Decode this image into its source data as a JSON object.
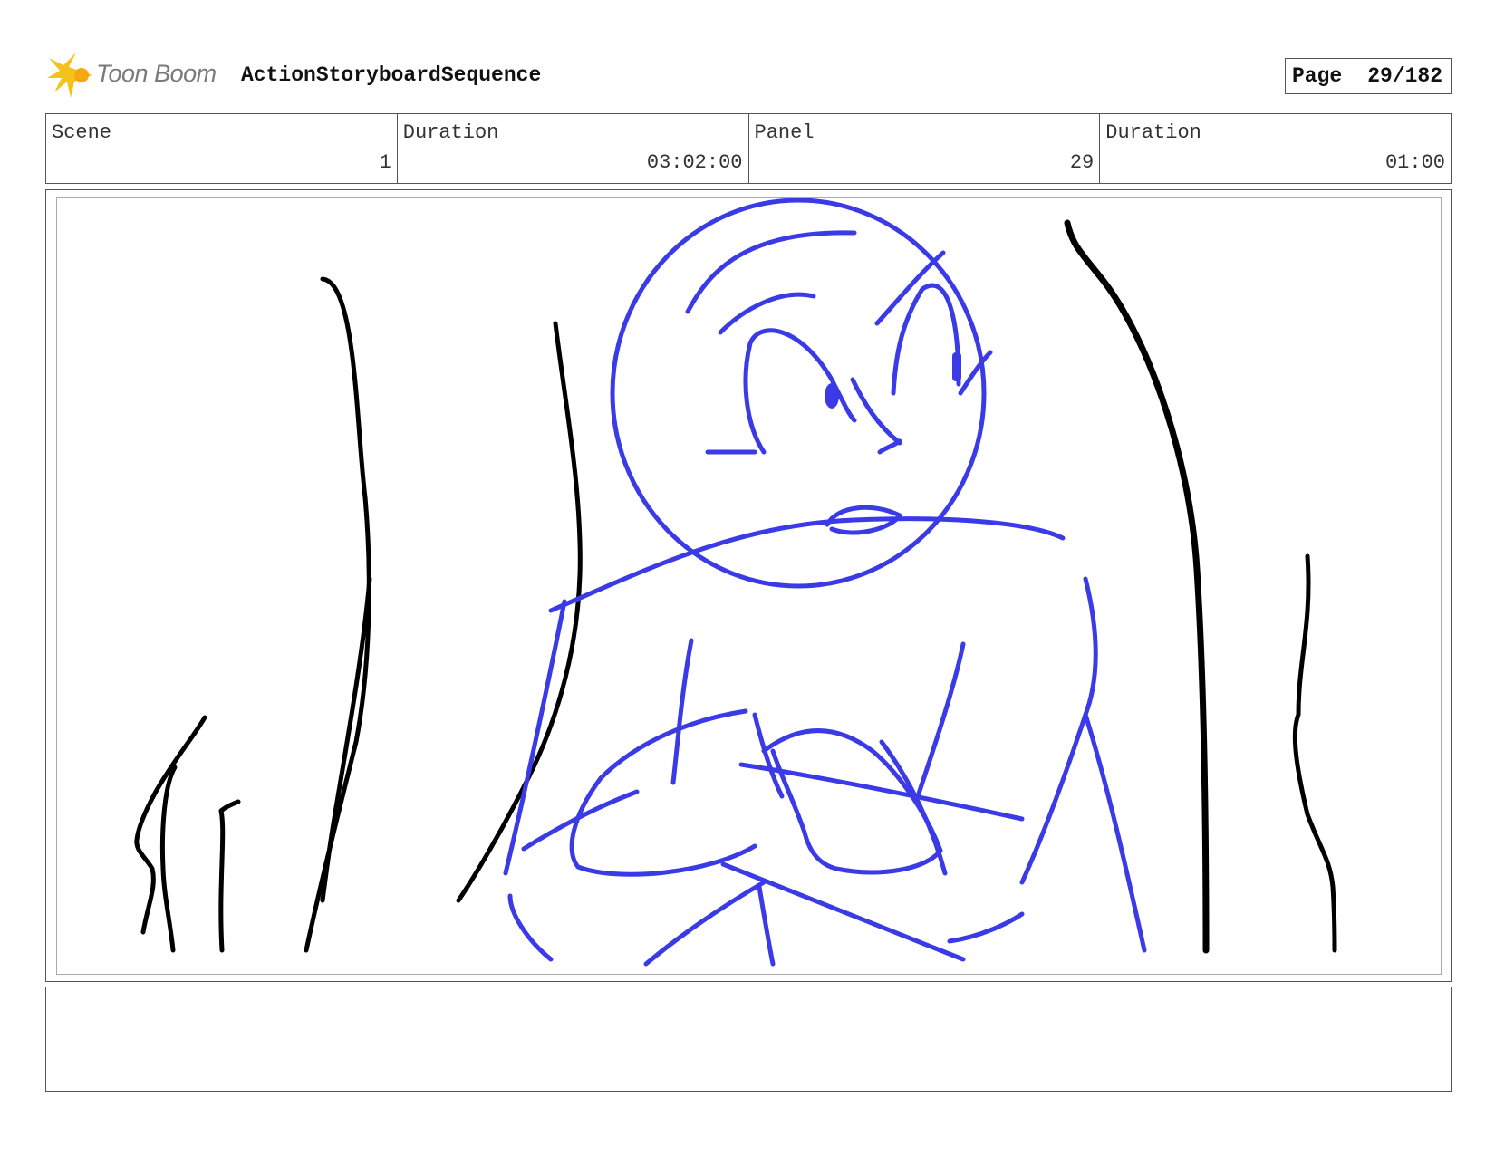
{
  "header": {
    "logo_text": "Toon Boom",
    "project_title": "ActionStoryboardSequence",
    "page_label": "Page",
    "page_number": "29/182"
  },
  "info": {
    "scene_label": "Scene",
    "scene_value": "1",
    "scene_duration_label": "Duration",
    "scene_duration_value": "03:02:00",
    "panel_label": "Panel",
    "panel_value": "29",
    "panel_duration_label": "Duration",
    "panel_duration_value": "01:00"
  },
  "colors": {
    "sketch_blue": "#3a3ae6",
    "sketch_black": "#000000",
    "logo_yellow": "#f5c21b"
  },
  "icons": {
    "logo": "toon-boom-starburst-icon"
  },
  "notes": {
    "text": ""
  }
}
